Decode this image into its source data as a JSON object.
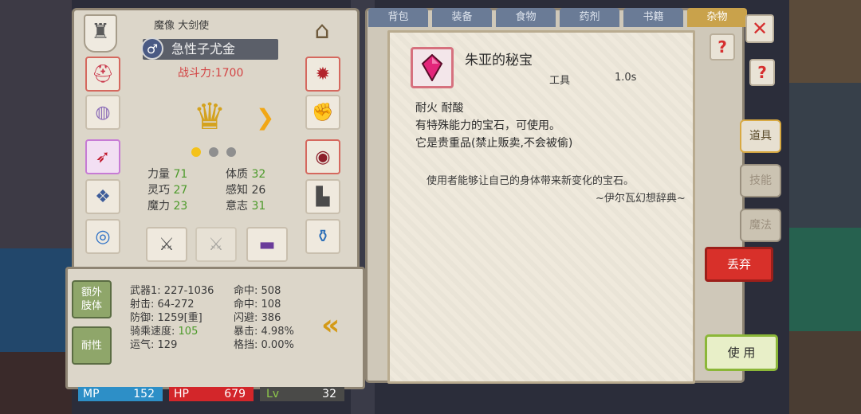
{
  "character": {
    "class_label": "魔像 大剑使",
    "gender_symbol": "♂",
    "name": "急性子尤金",
    "power": "战斗力:1700",
    "rank_icon": "shield-rank-icon",
    "attributes": [
      {
        "label": "力量",
        "value": "71"
      },
      {
        "label": "体质",
        "value": "32"
      },
      {
        "label": "灵巧",
        "value": "27"
      },
      {
        "label": "感知",
        "value": "26"
      },
      {
        "label": "魔力",
        "value": "23"
      },
      {
        "label": "意志",
        "value": "31"
      }
    ]
  },
  "stats": {
    "buttons": [
      "额外\n肢体",
      "耐性"
    ],
    "left": [
      {
        "label": "武器1:",
        "value": "227-1036"
      },
      {
        "label": "射击:",
        "value": "64-272"
      },
      {
        "label": "防御:",
        "value": "1259[重]"
      },
      {
        "label": "骑乘速度:",
        "value": "105"
      },
      {
        "label": "运气:",
        "value": "129"
      }
    ],
    "right": [
      {
        "label": "命中:",
        "value": "508"
      },
      {
        "label": "命中:",
        "value": "108"
      },
      {
        "label": "闪避:",
        "value": "386"
      },
      {
        "label": "暴击:",
        "value": "4.98%"
      },
      {
        "label": "格挡:",
        "value": "0.00%"
      }
    ]
  },
  "bars": {
    "mp_label": "MP",
    "mp_value": "152",
    "hp_label": "HP",
    "hp_value": "679",
    "lv_label": "Lv",
    "lv_value": "32",
    "colors": {
      "mp": "#2d8fc7",
      "hp": "#d3262a",
      "lv": "#4a4a48"
    }
  },
  "inventory": {
    "tabs": [
      "背包",
      "装备",
      "食物",
      "药剂",
      "书籍",
      "杂物"
    ],
    "active_tab": "杂物",
    "side_tabs": [
      "道具",
      "技能",
      "魔法"
    ],
    "discard_label": "丢弃",
    "use_label": "使 用"
  },
  "item": {
    "name": "朱亚的秘宝",
    "type": "工具",
    "weight": "1.0s",
    "desc_lines": [
      "耐火  耐酸",
      "有特殊能力的宝石，可使用。",
      "它是贵重品(禁止贩卖,不会被偷)"
    ],
    "flavor": "使用者能够让自己的身体带来新变化的宝石。",
    "source": "~伊尔瓦幻想辞典~",
    "gem_color": "#e3257a"
  }
}
